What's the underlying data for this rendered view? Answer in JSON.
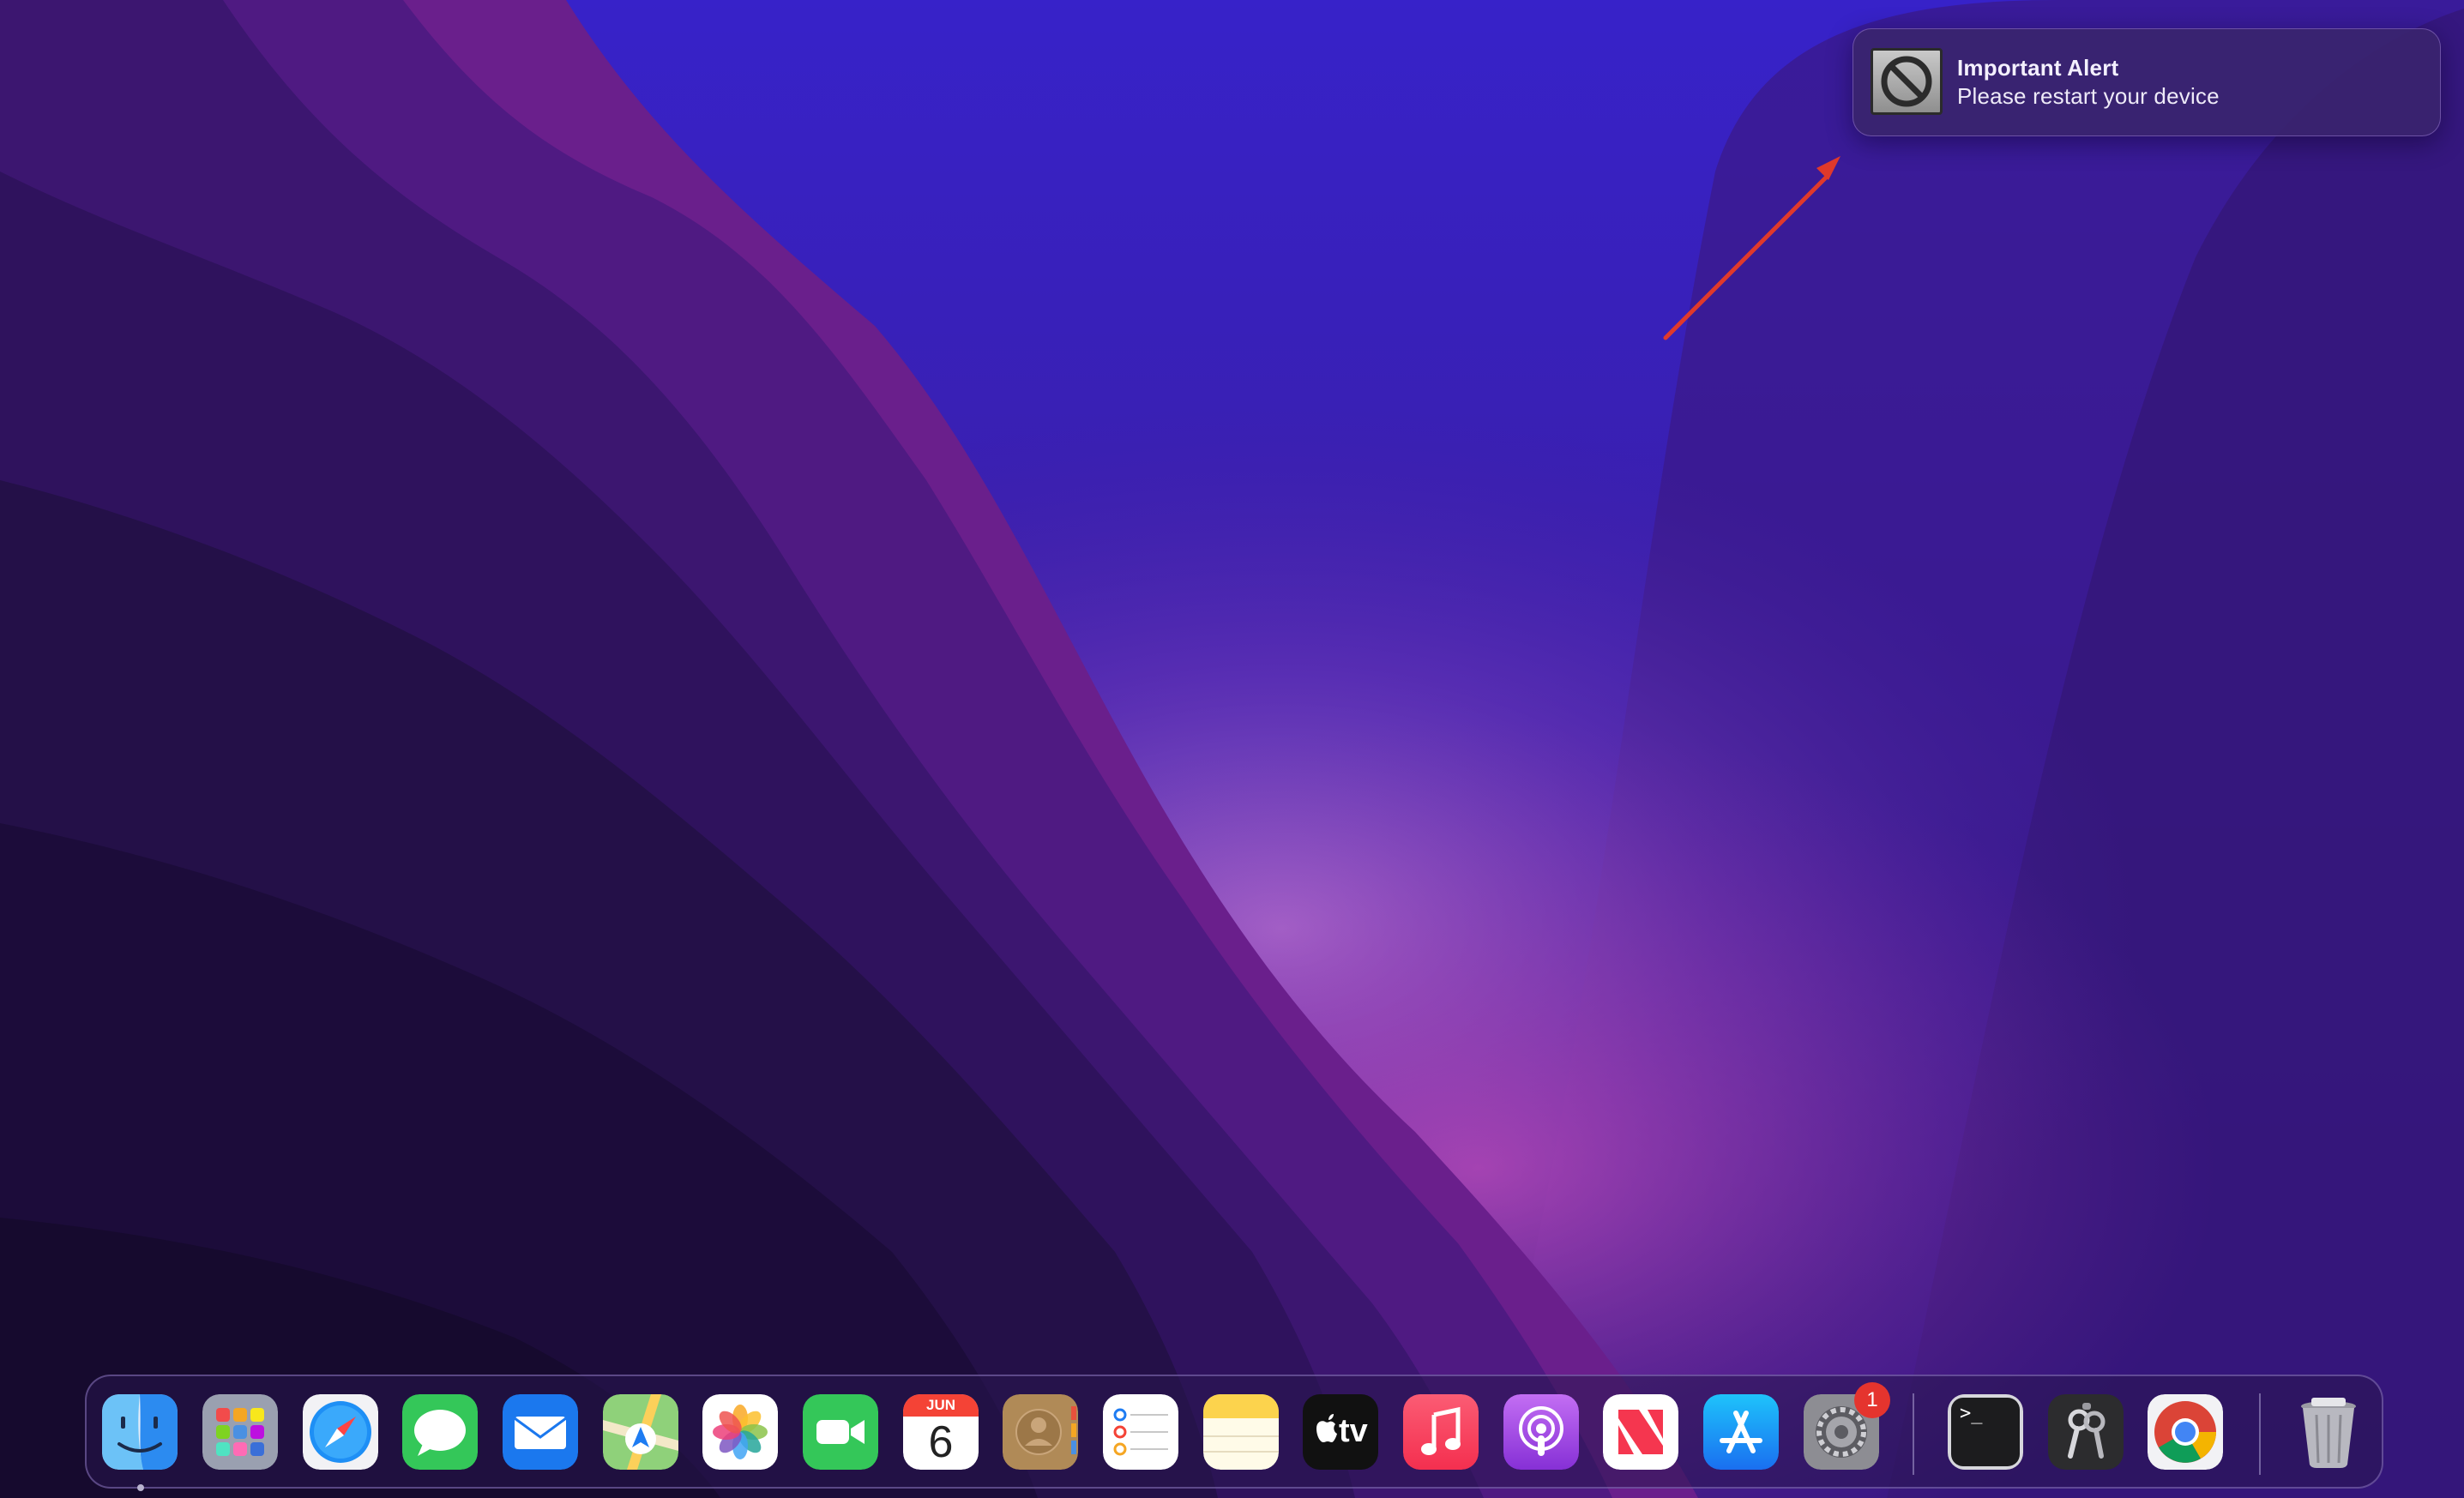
{
  "notification": {
    "title": "Important Alert",
    "body": "Please restart your device",
    "icon": "prohibited-icon"
  },
  "annotation": {
    "type": "arrow",
    "color": "#e0392b"
  },
  "dock": {
    "apps": [
      {
        "name": "Finder",
        "icon": "finder-icon",
        "running": true
      },
      {
        "name": "Launchpad",
        "icon": "launchpad-icon"
      },
      {
        "name": "Safari",
        "icon": "safari-icon"
      },
      {
        "name": "Messages",
        "icon": "messages-icon"
      },
      {
        "name": "Mail",
        "icon": "mail-icon"
      },
      {
        "name": "Maps",
        "icon": "maps-icon"
      },
      {
        "name": "Photos",
        "icon": "photos-icon"
      },
      {
        "name": "FaceTime",
        "icon": "facetime-icon"
      },
      {
        "name": "Calendar",
        "icon": "calendar-icon",
        "month": "JUN",
        "day": "6"
      },
      {
        "name": "Contacts",
        "icon": "contacts-icon"
      },
      {
        "name": "Reminders",
        "icon": "reminders-icon"
      },
      {
        "name": "Notes",
        "icon": "notes-icon"
      },
      {
        "name": "TV",
        "icon": "apple-tv-icon",
        "label": "tv"
      },
      {
        "name": "Music",
        "icon": "music-icon"
      },
      {
        "name": "Podcasts",
        "icon": "podcasts-icon"
      },
      {
        "name": "News",
        "icon": "news-icon"
      },
      {
        "name": "App Store",
        "icon": "app-store-icon"
      },
      {
        "name": "System Settings",
        "icon": "system-settings-icon",
        "badge": "1"
      },
      {
        "name": "Terminal",
        "icon": "terminal-icon",
        "prompt": ">_"
      },
      {
        "name": "Keychain Access",
        "icon": "keychain-icon"
      },
      {
        "name": "Google Chrome",
        "icon": "chrome-icon"
      },
      {
        "name": "Trash",
        "icon": "trash-icon"
      }
    ]
  },
  "colors": {
    "wallpaper_top": "#3a20c8",
    "wallpaper_dark": "#1a0a45",
    "badge": "#e5342e",
    "arrow": "#e0392b"
  }
}
